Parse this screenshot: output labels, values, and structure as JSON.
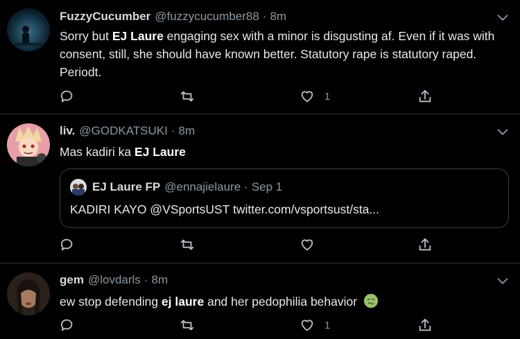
{
  "tweets": [
    {
      "name": "FuzzyCucumber",
      "handle": "@fuzzycucumber88",
      "dot": "·",
      "time": "8m",
      "text_parts": [
        "Sorry but ",
        "EJ Laure",
        " engaging sex with a minor is disgusting af. Even if it was with consent, still, she should have known better. Statutory rape is statutory raped. Periodt."
      ],
      "likes": "1",
      "icons": [
        "reply-icon",
        "retweet-icon",
        "heart-icon",
        "share-icon",
        "chevron-down-icon"
      ]
    },
    {
      "name": "liv.",
      "handle": "@GODKATSUKI",
      "dot": "·",
      "time": "8m",
      "text_parts": [
        "Mas kadiri ka ",
        "EJ Laure"
      ],
      "likes": "",
      "quote": {
        "name": "EJ Laure FP",
        "handle": "@ennajielaure",
        "dot": "·",
        "time": "Sep 1",
        "text": "KADIRI KAYO @VSportsUST twitter.com/vsportsust/sta..."
      }
    },
    {
      "name": "gem",
      "handle": "@lovdarls",
      "dot": "·",
      "time": "8m",
      "text_parts": [
        "ew stop defending ",
        "ej laure",
        " and her pedophilia behavior"
      ],
      "emoji": "nauseated-face-emoji",
      "likes": "1"
    }
  ],
  "colors": {
    "background": "#000000",
    "text": "#e7e9ea",
    "secondary": "#8b98a5",
    "divider": "#2f3336"
  }
}
